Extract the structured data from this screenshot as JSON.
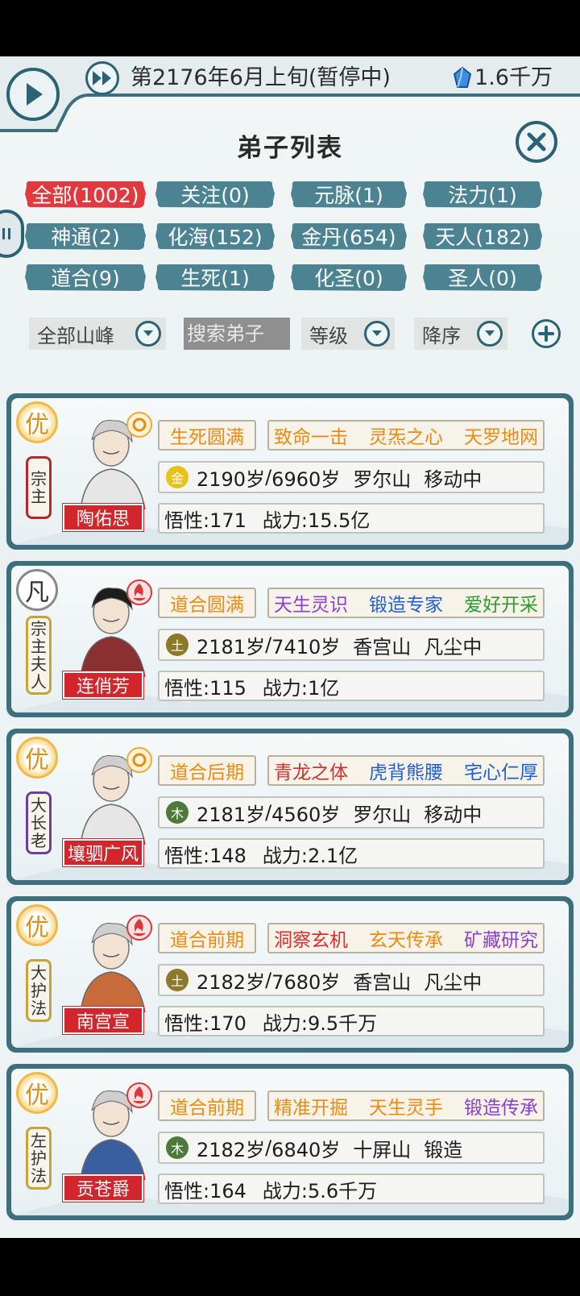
{
  "header": {
    "date": "第2176年6月上旬(暂停中)",
    "currency": "1.6千万",
    "title": "弟子列表"
  },
  "filters": [
    {
      "label": "全部(1002)",
      "active": true
    },
    {
      "label": "关注(0)",
      "active": false
    },
    {
      "label": "元脉(1)",
      "active": false
    },
    {
      "label": "法力(1)",
      "active": false
    },
    {
      "label": "神通(2)",
      "active": false
    },
    {
      "label": "化海(152)",
      "active": false
    },
    {
      "label": "金丹(654)",
      "active": false
    },
    {
      "label": "天人(182)",
      "active": false
    },
    {
      "label": "道合(9)",
      "active": false
    },
    {
      "label": "生死(1)",
      "active": false
    },
    {
      "label": "化圣(0)",
      "active": false
    },
    {
      "label": "圣人(0)",
      "active": false
    }
  ],
  "controls": {
    "mountain": "全部山峰",
    "search_placeholder": "搜索弟子",
    "sort_key": "等级",
    "sort_order": "降序"
  },
  "colors": {
    "accent": "#2b6274",
    "chip": "#4b8393",
    "chip_active": "#e2393f",
    "name_tag": "#d0262c"
  },
  "disciples": [
    {
      "grade": "优",
      "grade_style": "gold",
      "rank": [
        "宗",
        "主"
      ],
      "rank_color": "#b5282c",
      "name": "陶佑思",
      "badge": "sun",
      "stage": "生死圆满",
      "stage_color": "orange",
      "traits": [
        {
          "text": "致命一击",
          "color": "orange"
        },
        {
          "text": "灵炁之心",
          "color": "orange"
        },
        {
          "text": "天罗地网",
          "color": "orange"
        }
      ],
      "element": "金",
      "element_color": "#e6c21a",
      "age": "2190岁",
      "lifespan": "6960岁",
      "mountain": "罗尔山",
      "status": "移动中",
      "insight": "悟性:171",
      "power": "战力:15.5亿"
    },
    {
      "grade": "凡",
      "grade_style": "plain",
      "rank": [
        "宗",
        "主",
        "夫",
        "人"
      ],
      "rank_color": "#c9a23a",
      "name": "连俏芳",
      "badge": "flame",
      "stage": "道合圆满",
      "stage_color": "orange",
      "traits": [
        {
          "text": "天生灵识",
          "color": "purple"
        },
        {
          "text": "锻造专家",
          "color": "blue"
        },
        {
          "text": "爱好开采",
          "color": "green"
        }
      ],
      "element": "土",
      "element_color": "#8a7a2a",
      "age": "2181岁",
      "lifespan": "7410岁",
      "mountain": "香宫山",
      "status": "凡尘中",
      "insight": "悟性:115",
      "power": "战力:1亿"
    },
    {
      "grade": "优",
      "grade_style": "gold",
      "rank": [
        "大",
        "长",
        "老"
      ],
      "rank_color": "#6b3fa0",
      "name": "壤驷广风",
      "badge": "sun",
      "stage": "道合后期",
      "stage_color": "orange",
      "traits": [
        {
          "text": "青龙之体",
          "color": "red"
        },
        {
          "text": "虎背熊腰",
          "color": "blue"
        },
        {
          "text": "宅心仁厚",
          "color": "blue"
        }
      ],
      "element": "木",
      "element_color": "#4c7a3a",
      "age": "2181岁",
      "lifespan": "4560岁",
      "mountain": "罗尔山",
      "status": "移动中",
      "insight": "悟性:148",
      "power": "战力:2.1亿"
    },
    {
      "grade": "优",
      "grade_style": "gold",
      "rank": [
        "大",
        "护",
        "法"
      ],
      "rank_color": "#c9a23a",
      "name": "南宫宣",
      "badge": "flame",
      "stage": "道合前期",
      "stage_color": "orange",
      "traits": [
        {
          "text": "洞察玄机",
          "color": "red"
        },
        {
          "text": "玄天传承",
          "color": "orange"
        },
        {
          "text": "矿藏研究",
          "color": "purple"
        }
      ],
      "element": "土",
      "element_color": "#8a7a2a",
      "age": "2182岁",
      "lifespan": "7680岁",
      "mountain": "香宫山",
      "status": "凡尘中",
      "insight": "悟性:170",
      "power": "战力:9.5千万"
    },
    {
      "grade": "优",
      "grade_style": "gold",
      "rank": [
        "左",
        "护",
        "法"
      ],
      "rank_color": "#c9a23a",
      "name": "贡苍爵",
      "badge": "flame",
      "stage": "道合前期",
      "stage_color": "orange",
      "traits": [
        {
          "text": "精准开掘",
          "color": "orange"
        },
        {
          "text": "天生灵手",
          "color": "orange"
        },
        {
          "text": "锻造传承",
          "color": "purple"
        }
      ],
      "element": "木",
      "element_color": "#4c7a3a",
      "age": "2182岁",
      "lifespan": "6840岁",
      "mountain": "十屏山",
      "status": "锻造",
      "insight": "悟性:164",
      "power": "战力:5.6千万"
    }
  ]
}
